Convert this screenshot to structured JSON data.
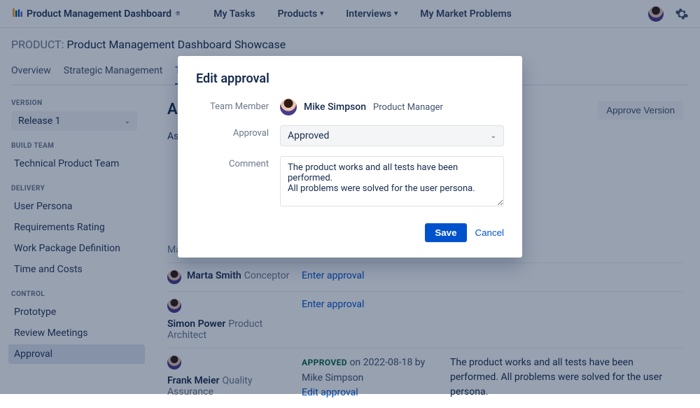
{
  "brand": "Product Management Dashboard",
  "brand_suffix": "®",
  "nav": {
    "my_tasks": "My Tasks",
    "products": "Products",
    "interviews": "Interviews",
    "market_problems": "My Market Problems"
  },
  "page": {
    "label": "PRODUCT:",
    "title": "Product Management Dashboard Showcase"
  },
  "tabs": {
    "overview": "Overview",
    "strategic": "Strategic Management",
    "technical_partial": "Techn"
  },
  "sidebar": {
    "version_label": "VERSION",
    "version_selected": "Release 1",
    "build_team_label": "BUILD TEAM",
    "build_team_item": "Technical Product Team",
    "delivery_label": "DELIVERY",
    "delivery": {
      "user_persona": "User Persona",
      "requirements": "Requirements Rating",
      "work_package": "Work Package Definition",
      "time_costs": "Time and Costs"
    },
    "control_label": "CONTROL",
    "control": {
      "prototype": "Prototype",
      "review_meetings": "Review Meetings",
      "approval": "Approval"
    }
  },
  "content": {
    "heading_partial": "A",
    "as_partial": "As",
    "approve_version_btn": "Approve Version",
    "manager_line": "Manager",
    "rows": [
      {
        "name": "Marta Smith",
        "role": "Conceptor",
        "action": "Enter approval"
      },
      {
        "name": "Simon Power",
        "role": "Product Architect",
        "action": "Enter approval"
      },
      {
        "name": "Frank Meier",
        "role": "Quality Assurance",
        "status": "APPROVED",
        "status_line": "on 2022-08-18 by Mike Simpson",
        "status_action": "Edit approval",
        "comment": "The product works and all tests have been performed. All problems were solved for the user persona."
      }
    ]
  },
  "modal": {
    "title": "Edit approval",
    "label_member": "Team Member",
    "member_name": "Mike Simpson",
    "member_role": "Product Manager",
    "label_approval": "Approval",
    "approval_value": "Approved",
    "label_comment": "Comment",
    "comment_value": "The product works and all tests have been performed.\nAll problems were solved for the user persona.",
    "save": "Save",
    "cancel": "Cancel"
  }
}
